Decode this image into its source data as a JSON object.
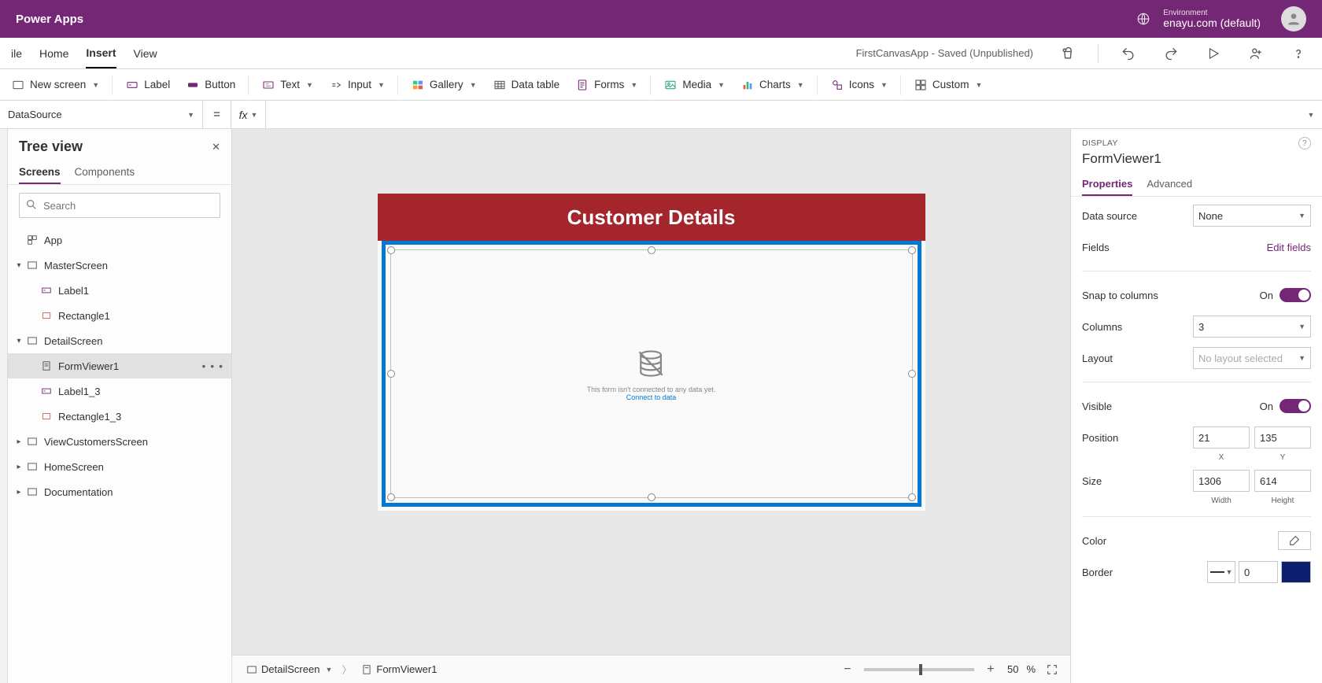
{
  "titlebar": {
    "app_name": "Power Apps",
    "env_caption": "Environment",
    "env_name": "enayu.com (default)"
  },
  "menu": {
    "items": [
      "ile",
      "Home",
      "Insert",
      "View"
    ],
    "active_index": 2,
    "status": "FirstCanvasApp - Saved (Unpublished)"
  },
  "ribbon": {
    "new_screen": "New screen",
    "label": "Label",
    "button": "Button",
    "text": "Text",
    "input": "Input",
    "gallery": "Gallery",
    "datatable": "Data table",
    "forms": "Forms",
    "media": "Media",
    "charts": "Charts",
    "icons": "Icons",
    "custom": "Custom"
  },
  "formula": {
    "property": "DataSource",
    "eq": "=",
    "fx": "fx",
    "value": ""
  },
  "tree": {
    "title": "Tree view",
    "tabs": [
      "Screens",
      "Components"
    ],
    "active_tab": 0,
    "search_placeholder": "Search",
    "app": "App",
    "items": [
      {
        "name": "MasterScreen",
        "children": [
          "Label1",
          "Rectangle1"
        ],
        "expanded": true
      },
      {
        "name": "DetailScreen",
        "children": [
          "FormViewer1",
          "Label1_3",
          "Rectangle1_3"
        ],
        "expanded": true,
        "selected_child": 0
      },
      {
        "name": "ViewCustomersScreen",
        "children": [],
        "expanded": false
      },
      {
        "name": "HomeScreen",
        "children": [],
        "expanded": false
      },
      {
        "name": "Documentation",
        "children": [],
        "expanded": false
      }
    ]
  },
  "canvas": {
    "header": "Customer Details",
    "empty_msg": "This form isn't connected to any data yet.",
    "empty_link": "Connect to data"
  },
  "status": {
    "crumb1": "DetailScreen",
    "crumb2": "FormViewer1",
    "zoom": "50",
    "pct": "%"
  },
  "props": {
    "caption": "DISPLAY",
    "name": "FormViewer1",
    "tabs": [
      "Properties",
      "Advanced"
    ],
    "active_tab": 0,
    "datasource_label": "Data source",
    "datasource_value": "None",
    "fields_label": "Fields",
    "edit_fields": "Edit fields",
    "snap_label": "Snap to columns",
    "on": "On",
    "columns_label": "Columns",
    "columns_value": "3",
    "layout_label": "Layout",
    "layout_value": "No layout selected",
    "visible_label": "Visible",
    "position_label": "Position",
    "pos_x": "21",
    "pos_y": "135",
    "pos_x_label": "X",
    "pos_y_label": "Y",
    "size_label": "Size",
    "size_w": "1306",
    "size_h": "614",
    "size_w_label": "Width",
    "size_h_label": "Height",
    "color_label": "Color",
    "border_label": "Border",
    "border_width": "0"
  }
}
